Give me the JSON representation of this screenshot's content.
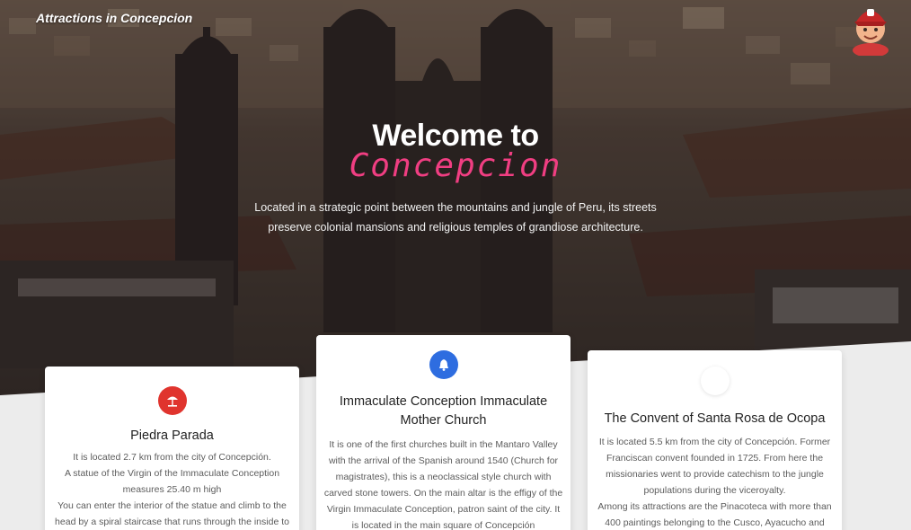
{
  "header": {
    "brand": "Attractions in Concepcion"
  },
  "hero": {
    "title": "Welcome to",
    "subtitle": "Concepcion",
    "description": "Located in a strategic point between the mountains and jungle of Peru, its streets preserve colonial mansions and religious temples of grandiose architecture."
  },
  "cards": [
    {
      "icon": "beach-umbrella-icon",
      "icon_color": "#e0342e",
      "title": "Piedra Parada",
      "body": "It is located 2.7 km from the city of Concepción.\nA statue of the Virgin of the Immaculate Conception measures 25.40 m high\nYou can enter the interior of the statue and climb to the head by a spiral staircase that runs through the inside to be able to"
    },
    {
      "icon": "bell-icon",
      "icon_color": "#2e6de0",
      "title": "Immaculate Conception Immaculate Mother Church",
      "body": "It is one of the first churches built in the Mantaro Valley with the arrival of the Spanish around 1540 (Church for magistrates), this is a neoclassical style church with carved stone towers. On the main altar is the effigy of the Virgin Immaculate Conception, patron saint of the city. It is located in the main square of Concepción"
    },
    {
      "icon": "blank-icon",
      "icon_color": "#ffffff",
      "title": "The Convent of Santa Rosa de Ocopa",
      "body": "It is located 5.5 km from the city of Concepción. Former Franciscan convent founded in 1725. From here the missionaries went to provide catechism to the jungle populations during the viceroyalty.\nAmong its attractions are the Pinacoteca with more than 400 paintings belonging to the Cusco, Ayacucho and Quito"
    }
  ],
  "colors": {
    "accent_pink": "#f03e82",
    "white": "#ffffff",
    "card_text": "#5c5c5c"
  }
}
